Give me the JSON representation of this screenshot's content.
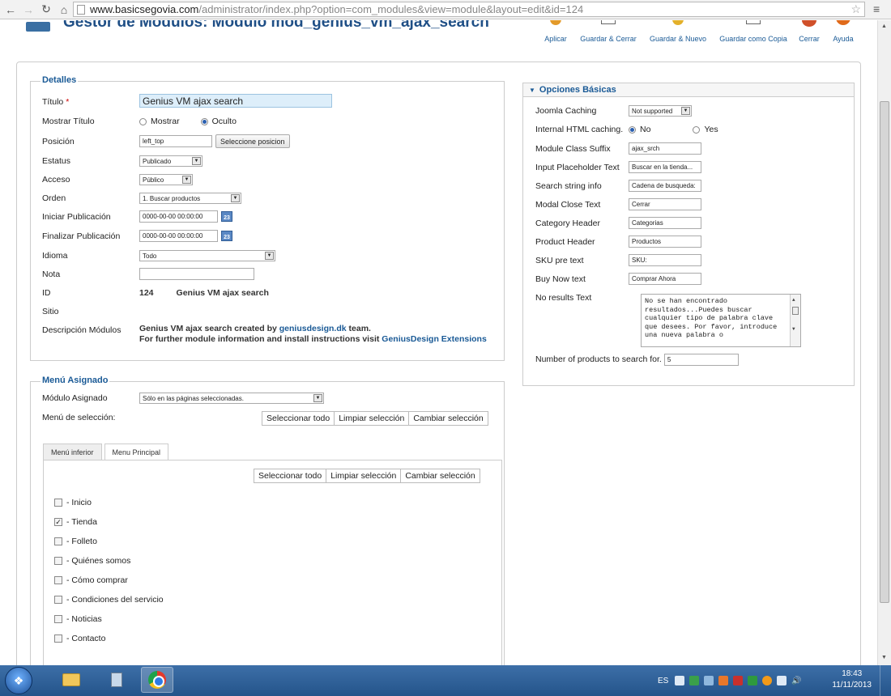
{
  "browser": {
    "url_host": "www.basicsegovia.com",
    "url_path": "/administrator/index.php?option=com_modules&view=module&layout=edit&id=124"
  },
  "toolbar": {
    "title": "Gestor de Módulos: Módulo mod_genius_vm_ajax_search",
    "buttons": [
      "Aplicar",
      "Guardar & Cerrar",
      "Guardar & Nuevo",
      "Guardar como Copia",
      "Cerrar",
      "Ayuda"
    ]
  },
  "details": {
    "legend": "Detalles",
    "labels": {
      "title": "Título",
      "required_mark": "*",
      "show_title": "Mostrar Título",
      "position": "Posición",
      "status": "Estatus",
      "access": "Acceso",
      "order": "Orden",
      "publish_up": "Iniciar Publicación",
      "publish_down": "Finalizar Publicación",
      "language": "Idioma",
      "note": "Nota",
      "id": "ID",
      "site": "Sitio",
      "description": "Descripción Módulos"
    },
    "title_value": "Genius VM ajax search",
    "show_title_options": [
      "Mostrar",
      "Oculto"
    ],
    "show_title_selected": "Oculto",
    "position_value": "left_top",
    "position_button": "Seleccione posicion",
    "status_value": "Publicado",
    "access_value": "Público",
    "order_value": "1. Buscar productos",
    "publish_up_value": "0000-00-00 00:00:00",
    "publish_down_value": "0000-00-00 00:00:00",
    "calendar_label": "23",
    "language_value": "Todo",
    "note_value": "",
    "id_value": "124",
    "id_name": "Genius VM ajax search",
    "desc_line1_prefix": "Genius VM ajax search created by ",
    "desc_line1_link": "geniusdesign.dk",
    "desc_line1_suffix": " team.",
    "desc_line2_prefix": "For further module information and install instructions visit ",
    "desc_line2_link": "GeniusDesign Extensions"
  },
  "options": {
    "legend": "Opciones Básicas",
    "fields": [
      {
        "label": "Joomla Caching",
        "type": "select",
        "value": "Not supported"
      },
      {
        "label": "Internal HTML caching.",
        "type": "radio",
        "options": [
          "No",
          "Yes"
        ],
        "value": "No"
      },
      {
        "label": "Module Class Suffix",
        "type": "text",
        "value": "ajax_srch"
      },
      {
        "label": "Input Placeholder Text",
        "type": "text",
        "value": "Buscar en la tienda..."
      },
      {
        "label": "Search string info",
        "type": "text",
        "value": "Cadena de busqueda:"
      },
      {
        "label": "Modal Close Text",
        "type": "text",
        "value": "Cerrar"
      },
      {
        "label": "Category Header",
        "type": "text",
        "value": "Categorias"
      },
      {
        "label": "Product Header",
        "type": "text",
        "value": "Productos"
      },
      {
        "label": "SKU pre text",
        "type": "text",
        "value": "SKU:"
      },
      {
        "label": "Buy Now text",
        "type": "text",
        "value": "Comprar Ahora"
      }
    ],
    "no_results_label": "No results Text",
    "no_results_value": "No se han encontrado resultados...Puedes buscar cualquier tipo de palabra clave que desees. Por favor, introduce una nueva palabra o",
    "num_products_label": "Number of products to search for.",
    "num_products_value": "5"
  },
  "menu": {
    "legend": "Menú Asignado",
    "assigned_label": "Módulo Asignado",
    "assigned_value": "Sólo en las páginas seleccionadas.",
    "selection_label": "Menú de selección:",
    "selection_buttons": [
      "Seleccionar todo",
      "Limpiar selección",
      "Cambiar selección"
    ],
    "tabs": [
      "Menú inferior",
      "Menu Principal"
    ],
    "active_tab": "Menu Principal",
    "items": [
      {
        "label": "- Inicio",
        "checked": false
      },
      {
        "label": "- Tienda",
        "checked": true
      },
      {
        "label": "- Folleto",
        "checked": false
      },
      {
        "label": "- Quiénes somos",
        "checked": false
      },
      {
        "label": "- Cómo comprar",
        "checked": false
      },
      {
        "label": "- Condiciones del servicio",
        "checked": false
      },
      {
        "label": "- Noticias",
        "checked": false
      },
      {
        "label": "- Contacto",
        "checked": false
      }
    ]
  },
  "taskbar": {
    "language": "ES",
    "time": "18:43",
    "date": "11/11/2013"
  },
  "colors": {
    "accent": "#1a5a96",
    "heading": "#1f4f86",
    "required": "#cc0000",
    "taskbar": "#2d5f98"
  }
}
